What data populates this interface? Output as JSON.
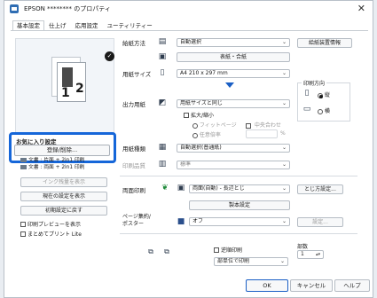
{
  "window": {
    "title": "EPSON ******** のプロパティ",
    "close_icon": "close-icon"
  },
  "tabs": [
    {
      "label": "基本設定",
      "active": true
    },
    {
      "label": "仕上げ",
      "active": false
    },
    {
      "label": "応用設定",
      "active": false
    },
    {
      "label": "ユーティリティー",
      "active": false
    }
  ],
  "preview": {
    "page1": "1",
    "page2": "2"
  },
  "favorites": {
    "title": "お気に入り設定",
    "register_button": "登録/削除...",
    "items": [
      "文書 : 片面 + 2in1 印刷",
      "文書 : 両面 + 2in1 印刷"
    ]
  },
  "left_buttons": {
    "ink_remaining": "インク残量を表示",
    "current_settings": "現在の設定を表示",
    "reset_defaults": "初期設定に戻す"
  },
  "left_checkboxes": {
    "print_preview": "印刷プレビューを表示",
    "print_lite": "まとめてプリント Lite"
  },
  "settings": {
    "paper_source": {
      "label": "給紙方法",
      "value": "自動選択",
      "button": "給紙装置情報"
    },
    "front_back_button": "表紙・合紙",
    "paper_size": {
      "label": "用紙サイズ",
      "value": "A4 210 x 297 mm"
    },
    "output_paper": {
      "label": "出力用紙",
      "value": "用紙サイズと同じ"
    },
    "scale": {
      "label": "拡大/縮小",
      "fit_page": "フィットページ",
      "center": "中央合わせ",
      "any_ratio": "任意倍率",
      "percent": "%"
    },
    "paper_type": {
      "label": "用紙種類",
      "value": "自動選択(普通紙)"
    },
    "print_quality": {
      "label": "印刷品質",
      "value": "標準"
    },
    "duplex": {
      "label": "両面印刷",
      "value": "両面(自動) - 長辺とじ",
      "margin_button": "とじ方設定...",
      "booklet_button": "製本設定"
    },
    "multi_page": {
      "label": "ページ集約/\nポスター",
      "value": "オフ",
      "settings_button": "設定..."
    },
    "reverse_order": "逆順印刷",
    "collate": "部単位で印刷",
    "copies": {
      "label": "部数",
      "value": "1"
    }
  },
  "orientation": {
    "title": "印刷方向",
    "portrait": "縦",
    "landscape": "横",
    "selected": "portrait"
  },
  "footer": {
    "ok": "OK",
    "cancel": "キャンセル",
    "help": "ヘルプ"
  },
  "colors": {
    "accent": "#1566d9"
  }
}
